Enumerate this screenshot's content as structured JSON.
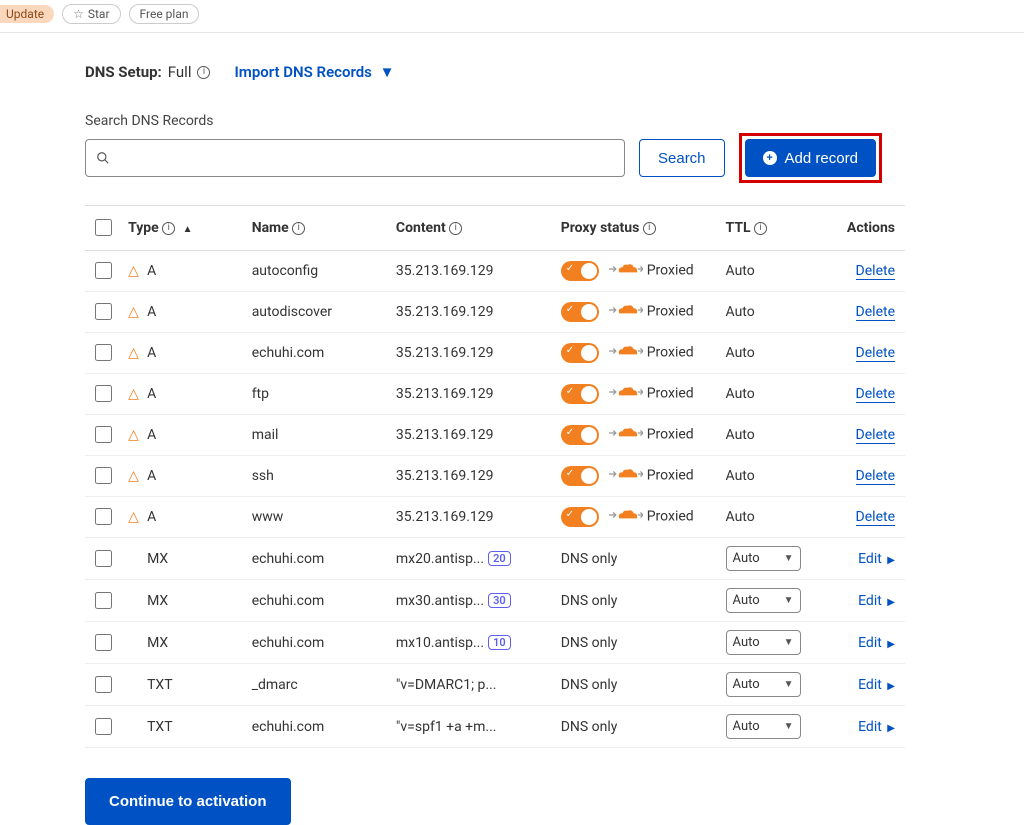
{
  "topbar": {
    "update_label": "Update",
    "star_label": "Star",
    "plan_label": "Free plan"
  },
  "dns": {
    "setup_label": "DNS Setup:",
    "setup_value": "Full",
    "import_label": "Import DNS Records",
    "search_label": "Search DNS Records",
    "search_button": "Search",
    "add_record_button": "Add record",
    "continue_button": "Continue to activation",
    "columns": {
      "type": "Type",
      "name": "Name",
      "content": "Content",
      "proxy": "Proxy status",
      "ttl": "TTL",
      "actions": "Actions"
    },
    "proxied_label": "Proxied",
    "dnsonly_label": "DNS only",
    "ttl_auto": "Auto",
    "delete_label": "Delete",
    "edit_label": "Edit"
  },
  "records": [
    {
      "warn": true,
      "type": "A",
      "name": "autoconfig",
      "content": "35.213.169.129",
      "priority": null,
      "proxied": true,
      "ttl": "Auto",
      "action": "Delete"
    },
    {
      "warn": true,
      "type": "A",
      "name": "autodiscover",
      "content": "35.213.169.129",
      "priority": null,
      "proxied": true,
      "ttl": "Auto",
      "action": "Delete"
    },
    {
      "warn": true,
      "type": "A",
      "name": "echuhi.com",
      "content": "35.213.169.129",
      "priority": null,
      "proxied": true,
      "ttl": "Auto",
      "action": "Delete"
    },
    {
      "warn": true,
      "type": "A",
      "name": "ftp",
      "content": "35.213.169.129",
      "priority": null,
      "proxied": true,
      "ttl": "Auto",
      "action": "Delete"
    },
    {
      "warn": true,
      "type": "A",
      "name": "mail",
      "content": "35.213.169.129",
      "priority": null,
      "proxied": true,
      "ttl": "Auto",
      "action": "Delete"
    },
    {
      "warn": true,
      "type": "A",
      "name": "ssh",
      "content": "35.213.169.129",
      "priority": null,
      "proxied": true,
      "ttl": "Auto",
      "action": "Delete"
    },
    {
      "warn": true,
      "type": "A",
      "name": "www",
      "content": "35.213.169.129",
      "priority": null,
      "proxied": true,
      "ttl": "Auto",
      "action": "Delete"
    },
    {
      "warn": false,
      "type": "MX",
      "name": "echuhi.com",
      "content": "mx20.antisp...",
      "priority": "20",
      "proxied": false,
      "ttl": "Auto",
      "action": "Edit"
    },
    {
      "warn": false,
      "type": "MX",
      "name": "echuhi.com",
      "content": "mx30.antisp...",
      "priority": "30",
      "proxied": false,
      "ttl": "Auto",
      "action": "Edit"
    },
    {
      "warn": false,
      "type": "MX",
      "name": "echuhi.com",
      "content": "mx10.antisp...",
      "priority": "10",
      "proxied": false,
      "ttl": "Auto",
      "action": "Edit"
    },
    {
      "warn": false,
      "type": "TXT",
      "name": "_dmarc",
      "content": "\"v=DMARC1; p...",
      "priority": null,
      "proxied": false,
      "ttl": "Auto",
      "action": "Edit"
    },
    {
      "warn": false,
      "type": "TXT",
      "name": "echuhi.com",
      "content": "\"v=spf1 +a +m...",
      "priority": null,
      "proxied": false,
      "ttl": "Auto",
      "action": "Edit"
    }
  ]
}
